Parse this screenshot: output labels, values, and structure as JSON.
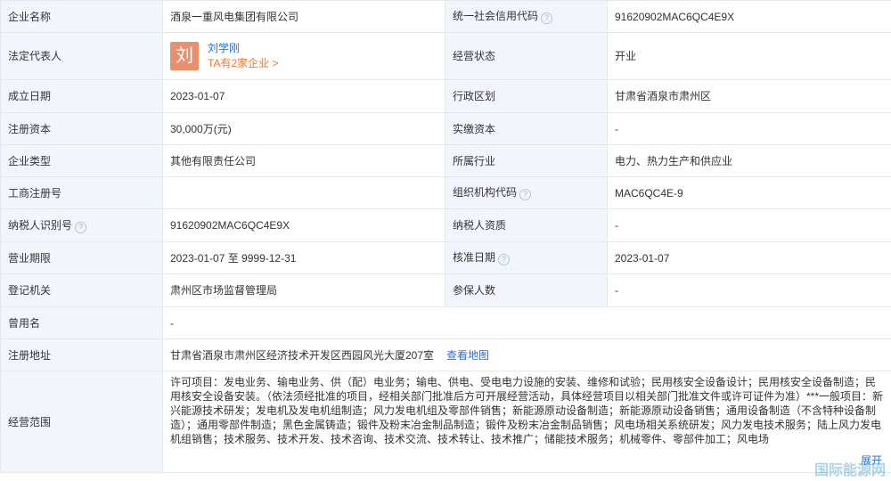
{
  "rows": {
    "company_name": {
      "label": "企业名称",
      "value": "酒泉一重风电集团有限公司"
    },
    "credit_code": {
      "label": "统一社会信用代码",
      "value": "91620902MAC6QC4E9X"
    },
    "legal_rep": {
      "label": "法定代表人",
      "avatar": "刘",
      "name": "刘学刚",
      "companies": "TA有2家企业 >"
    },
    "status": {
      "label": "经营状态",
      "value": "开业"
    },
    "established": {
      "label": "成立日期",
      "value": "2023-01-07"
    },
    "region": {
      "label": "行政区划",
      "value": "甘肃省酒泉市肃州区"
    },
    "reg_capital": {
      "label": "注册资本",
      "value": "30,000万(元)"
    },
    "paid_capital": {
      "label": "实缴资本",
      "value": "-"
    },
    "company_type": {
      "label": "企业类型",
      "value": "其他有限责任公司"
    },
    "industry": {
      "label": "所属行业",
      "value": "电力、热力生产和供应业"
    },
    "biz_reg_no": {
      "label": "工商注册号",
      "value": ""
    },
    "org_code": {
      "label": "组织机构代码",
      "value": "MAC6QC4E-9"
    },
    "taxpayer_id": {
      "label": "纳税人识别号",
      "value": "91620902MAC6QC4E9X"
    },
    "taxpayer_qual": {
      "label": "纳税人资质",
      "value": "-"
    },
    "term": {
      "label": "营业期限",
      "value": "2023-01-07 至 9999-12-31"
    },
    "approval_date": {
      "label": "核准日期",
      "value": "2023-01-07"
    },
    "reg_authority": {
      "label": "登记机关",
      "value": "肃州区市场监督管理局"
    },
    "insured": {
      "label": "参保人数",
      "value": "-"
    },
    "former_name": {
      "label": "曾用名",
      "value": "-"
    },
    "address": {
      "label": "注册地址",
      "value": "甘肃省酒泉市肃州区经济技术开发区西园风光大厦207室",
      "map_link": "查看地图"
    },
    "scope": {
      "label": "经营范围",
      "value": "许可项目：发电业务、输电业务、供（配）电业务；输电、供电、受电电力设施的安装、维修和试验；民用核安全设备设计；民用核安全设备制造；民用核安全设备安装。（依法须经批准的项目，经相关部门批准后方可开展经营活动，具体经营项目以相关部门批准文件或许可证件为准）***一般项目：新兴能源技术研发；发电机及发电机组制造；风力发电机组及零部件销售；新能源原动设备制造；新能源原动设备销售；通用设备制造（不含特种设备制造）；通用零部件制造；黑色金属铸造；锻件及粉末冶金制品制造；锻件及粉末冶金制品销售；风电场相关系统研发；风力发电技术服务；陆上风力发电机组销售；技术服务、技术开发、技术咨询、技术交流、技术转让、技术推广；储能技术服务；机械零件、零部件加工；风电场",
      "expand": "展开"
    }
  },
  "help_icon": "question-circle-icon",
  "watermark": "国际能源网",
  "colors": {
    "label_bg": "#f2f6fc",
    "border": "#e4e8ef",
    "link": "#2a70d6",
    "orange": "#ed7b32",
    "avatar": "#e98f6b"
  }
}
